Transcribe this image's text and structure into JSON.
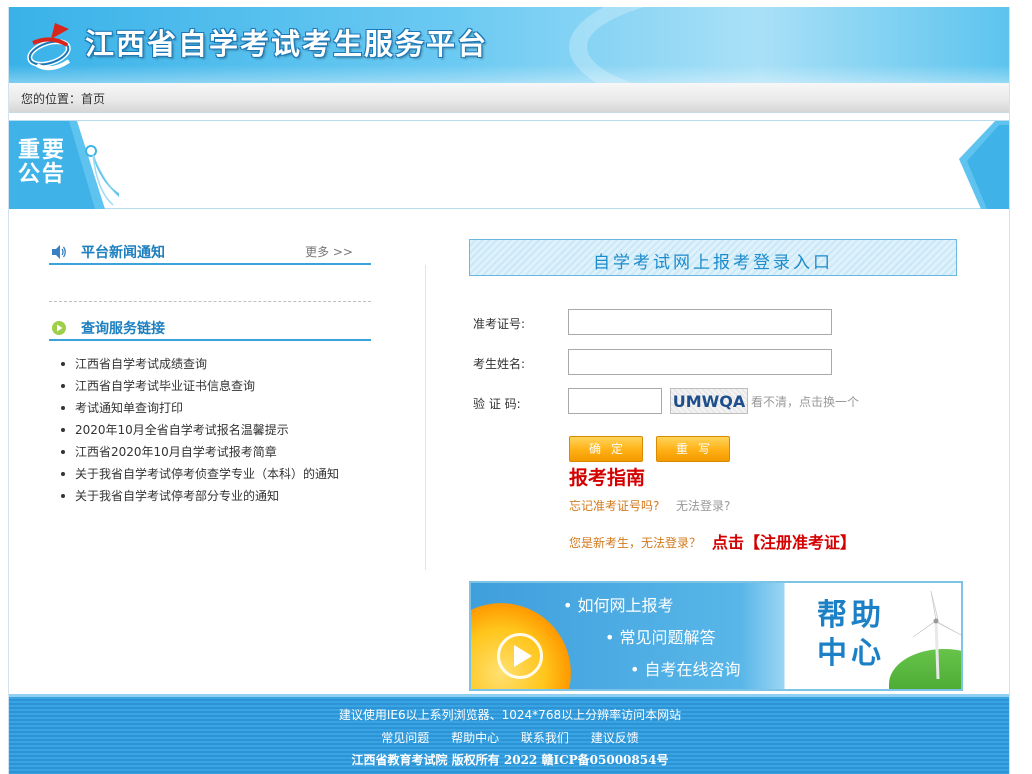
{
  "header": {
    "site_title": "江西省自学考试考生服务平台"
  },
  "breadcrumb": {
    "label": "您的位置：",
    "current": "首页"
  },
  "notice": {
    "title": "重要公告"
  },
  "news": {
    "title": "平台新闻通知",
    "more": "更多 >>"
  },
  "links": {
    "title": "查询服务链接",
    "items": [
      "江西省自学考试成绩查询",
      "江西省自学考试毕业证书信息查询",
      "考试通知单查询打印",
      "2020年10月全省自学考试报名温馨提示",
      "江西省2020年10月自学考试报考简章",
      "关于我省自学考试停考侦查学专业（本科）的通知",
      "关于我省自学考试停考部分专业的通知"
    ]
  },
  "login": {
    "title": "自学考试网上报考登录入口",
    "id_label": "准考证号:",
    "name_label": "考生姓名:",
    "code_label": "验 证 码:",
    "id_value": "",
    "name_value": "",
    "code_value": "",
    "captcha_text": "UMWQA",
    "captcha_refresh": "看不清，点击换一个",
    "ok_button": "确定",
    "reset_button": "重写",
    "guide": "报考指南",
    "forgot": "忘记准考证号吗?",
    "cannot_login": "无法登录?",
    "new_student": "您是新考生，无法登录？",
    "register": "点击【注册准考证】"
  },
  "help": {
    "items": [
      "• 如何网上报考",
      "• 常见问题解答",
      "• 自考在线咨询"
    ],
    "center_title": "帮助中心"
  },
  "footer": {
    "tip": "建议使用IE6以上系列浏览器、1024*768以上分辨率访问本网站",
    "links": [
      "常见问题",
      "帮助中心",
      "联系我们",
      "建议反馈"
    ],
    "copyright": "江西省教育考试院 版权所有 2022 赣ICP备05000854号"
  },
  "colors": {
    "accent_blue": "#1c8ccc",
    "header_blue": "#39b2e8",
    "button_orange": "#ffb015",
    "alert_red": "#d40000",
    "link_orange": "#d27a1e"
  }
}
